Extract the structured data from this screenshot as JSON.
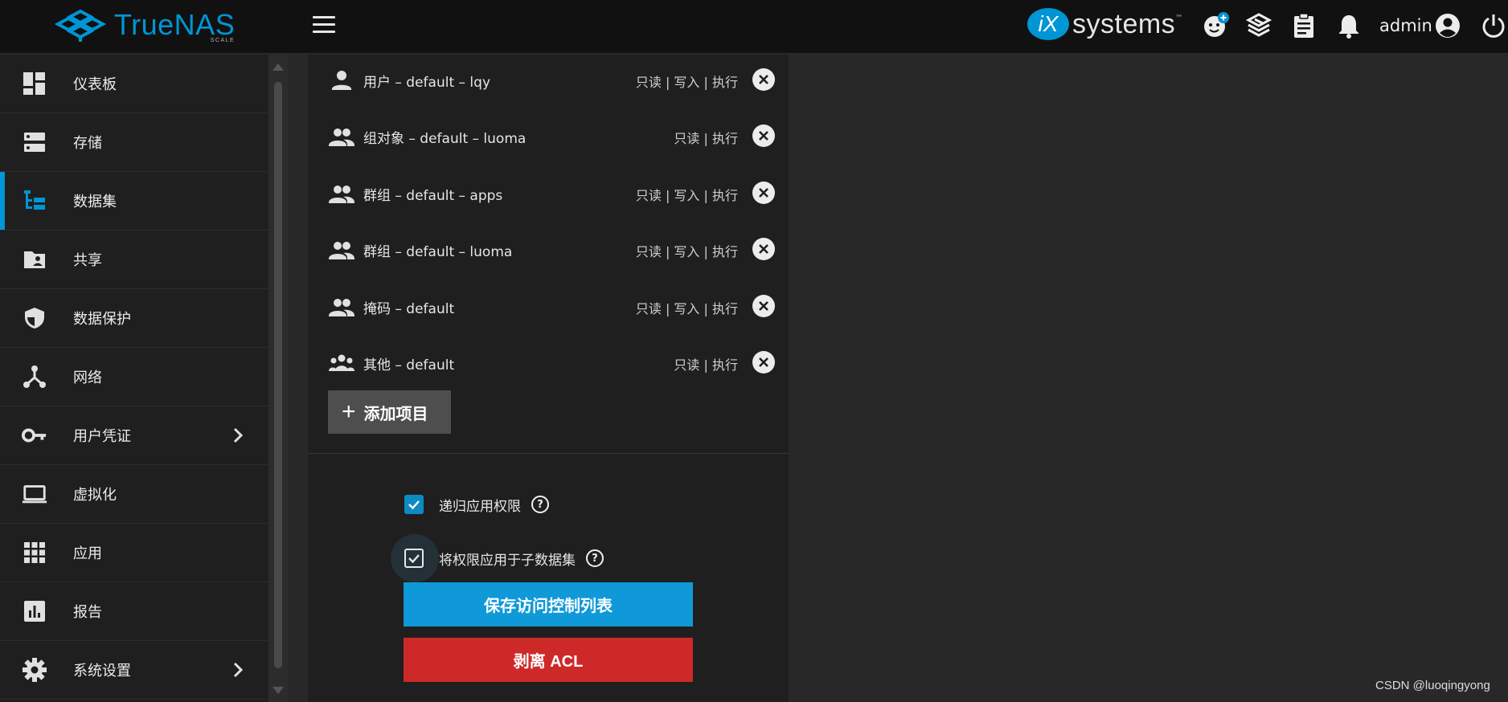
{
  "header": {
    "brand_name": "TrueNAS",
    "brand_sub": "SCALE",
    "vendor_mark": "iX",
    "vendor_word": "systems",
    "vendor_tm": "™",
    "user_name": "admin",
    "colors": {
      "brand": "#0095d5",
      "bar": "#111111"
    },
    "icons": [
      "menu-icon",
      "feedback-icon",
      "truecommand-icon",
      "jobs-icon",
      "alerts-icon",
      "account-icon",
      "power-icon"
    ]
  },
  "sidebar": {
    "items": [
      {
        "label": "仪表板",
        "icon": "dashboard-icon"
      },
      {
        "label": "存储",
        "icon": "storage-icon"
      },
      {
        "label": "数据集",
        "icon": "datasets-icon",
        "active": true
      },
      {
        "label": "共享",
        "icon": "shares-icon"
      },
      {
        "label": "数据保护",
        "icon": "data-protection-icon"
      },
      {
        "label": "网络",
        "icon": "network-icon"
      },
      {
        "label": "用户凭证",
        "icon": "credentials-icon",
        "has_children": true
      },
      {
        "label": "虚拟化",
        "icon": "virtualization-icon"
      },
      {
        "label": "应用",
        "icon": "apps-icon"
      },
      {
        "label": "报告",
        "icon": "reporting-icon"
      },
      {
        "label": "系统设置",
        "icon": "system-settings-icon",
        "has_children": true
      }
    ]
  },
  "acl": {
    "entries": [
      {
        "name": "用户 – default – lqy",
        "perms": "只读 | 写入 | 执行",
        "icon": "user-icon"
      },
      {
        "name": "组对象 – default – luoma",
        "perms": "只读 | 执行",
        "icon": "group-icon"
      },
      {
        "name": "群组 – default – apps",
        "perms": "只读 | 写入 | 执行",
        "icon": "group-icon"
      },
      {
        "name": "群组 – default – luoma",
        "perms": "只读 | 写入 | 执行",
        "icon": "group-icon"
      },
      {
        "name": "掩码 – default",
        "perms": "只读 | 写入 | 执行",
        "icon": "group-icon"
      },
      {
        "name": "其他 – default",
        "perms": "只读 | 执行",
        "icon": "others-icon"
      }
    ],
    "add_label": "添加项目",
    "options": {
      "recursive_label": "递归应用权限",
      "recursive_checked": true,
      "children_label": "将权限应用于子数据集",
      "children_checked": true
    },
    "save_label": "保存访问控制列表",
    "strip_label": "剥离 ACL",
    "colors": {
      "save": "#0f99d8",
      "strip": "#ce2929",
      "checkbox": "#0e89c2"
    }
  },
  "watermark": "CSDN @luoqingyong"
}
